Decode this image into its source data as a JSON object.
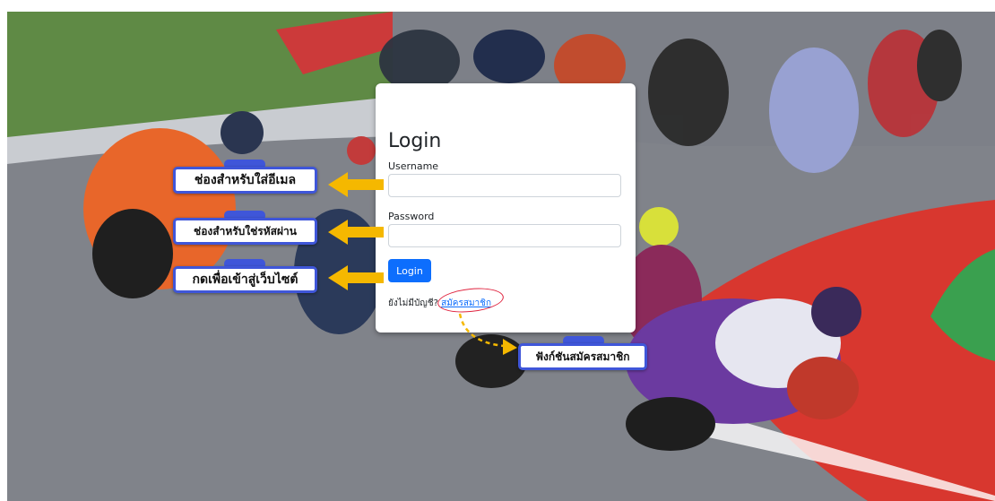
{
  "login": {
    "title": "Login",
    "username_label": "Username",
    "username_value": "",
    "password_label": "Password",
    "password_value": "",
    "button_label": "Login",
    "no_account_text": "ยังไม่มีบัญชี?",
    "signup_link": "สมัครสมาชิก"
  },
  "annotations": {
    "email_field": "ช่องสำหรับใส่อีเมล",
    "password_field": "ช่องสำหรับใช่รหัสผ่าน",
    "login_button": "กดเพื่อเข้าสู่เว็บไซต์",
    "signup_function": "ฟังก์ชันสมัครสมาชิก"
  },
  "colors": {
    "primary_button": "#0d6efd",
    "callout_border": "#3f56d9",
    "arrow": "#f5b800",
    "highlight_ring": "#e0243f"
  }
}
